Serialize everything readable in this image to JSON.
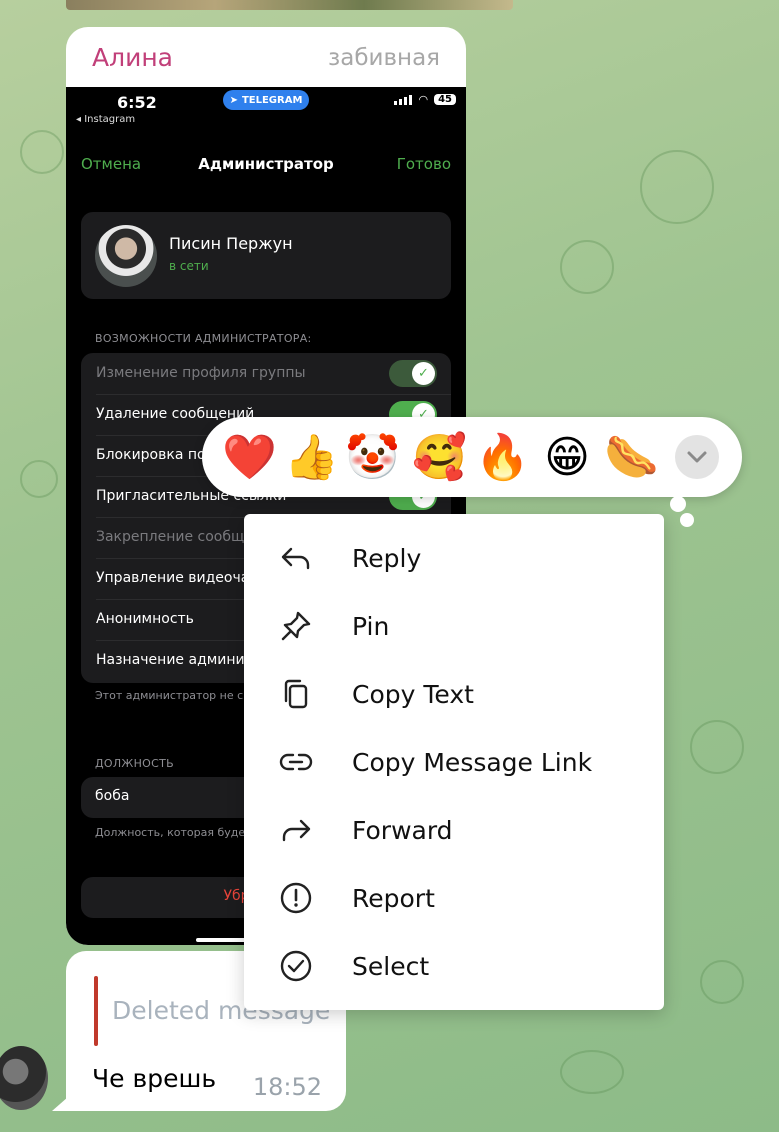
{
  "message": {
    "sender": "Алина",
    "tag": "забивная",
    "screenshot": {
      "status_time": "6:52",
      "back_app": "◂ Instagram",
      "pill_label": "TELEGRAM",
      "battery": "45",
      "nav_cancel": "Отмена",
      "nav_title": "Администратор",
      "nav_done": "Готово",
      "profile_name": "Писин Пержун",
      "profile_status": "в сети",
      "rights_header": "ВОЗМОЖНОСТИ АДМИНИСТРАТОРА:",
      "permissions": [
        {
          "label": "Изменение профиля группы",
          "enabled": true,
          "dim": true
        },
        {
          "label": "Удаление сообщений",
          "enabled": true,
          "dim": false
        },
        {
          "label": "Блокировка по",
          "enabled": true,
          "dim": false
        },
        {
          "label": "Пригласительные ссылки",
          "enabled": true,
          "dim": false
        },
        {
          "label": "Закрепление сообщ",
          "enabled": false,
          "dim": true
        },
        {
          "label": "Управление видеоча",
          "enabled": false,
          "dim": false
        },
        {
          "label": "Анонимность",
          "enabled": false,
          "dim": false
        },
        {
          "label": "Назначение админи",
          "enabled": false,
          "dim": false
        }
      ],
      "rights_note": "Этот администратор не с администраторов.",
      "role_header": "ДОЛЖНОСТЬ",
      "role_value": "боба",
      "role_note": "Должность, которая буде вместо «админ».",
      "remove_label": "Убрать из а"
    }
  },
  "second_message": {
    "reply_text": "Deleted message",
    "text": "Че врешь",
    "time": "18:52"
  },
  "reactions": [
    {
      "emoji": "❤️",
      "name": "heart"
    },
    {
      "emoji": "👍",
      "name": "thumbs-up"
    },
    {
      "emoji": "🤡",
      "name": "clown"
    },
    {
      "emoji": "🥰",
      "name": "smiling-hearts"
    },
    {
      "emoji": "🔥",
      "name": "fire"
    },
    {
      "emoji": "😁",
      "name": "grin"
    },
    {
      "emoji": "🌭",
      "name": "hotdog"
    }
  ],
  "context_menu": [
    {
      "label": "Reply",
      "icon": "reply-icon"
    },
    {
      "label": "Pin",
      "icon": "pin-icon"
    },
    {
      "label": "Copy Text",
      "icon": "copy-icon"
    },
    {
      "label": "Copy Message Link",
      "icon": "link-icon"
    },
    {
      "label": "Forward",
      "icon": "forward-icon"
    },
    {
      "label": "Report",
      "icon": "report-icon"
    },
    {
      "label": "Select",
      "icon": "select-icon"
    }
  ],
  "colors": {
    "sender": "#c13f79",
    "accent_green": "#4fae4e",
    "danger": "#e8443a"
  }
}
